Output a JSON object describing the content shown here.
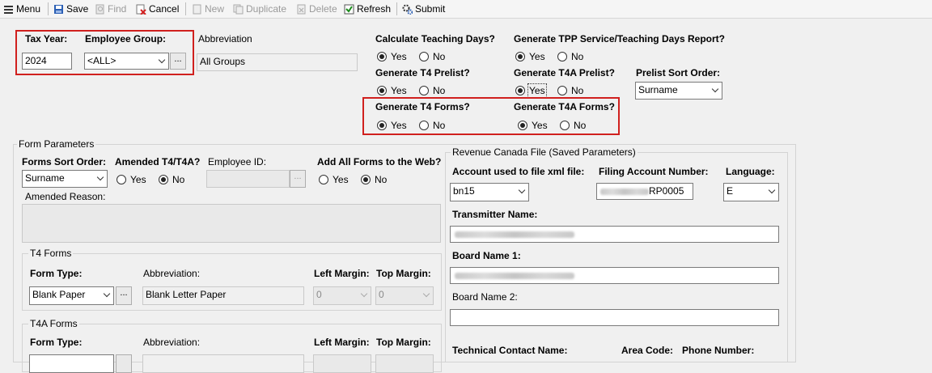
{
  "toolbar": {
    "menu": "Menu",
    "save": "Save",
    "find": "Find",
    "cancel": "Cancel",
    "new": "New",
    "duplicate": "Duplicate",
    "delete": "Delete",
    "refresh": "Refresh",
    "submit": "Submit"
  },
  "header": {
    "tax_year_label": "Tax Year:",
    "tax_year_value": "2024",
    "employee_group_label": "Employee Group:",
    "employee_group_value": "<ALL>",
    "abbreviation_label": "Abbreviation",
    "abbreviation_value": "All Groups"
  },
  "options": {
    "calc_teaching_days": "Calculate Teaching Days?",
    "gen_tpp_report": "Generate TPP Service/Teaching Days Report?",
    "gen_t4_prelist": "Generate T4 Prelist?",
    "gen_t4a_prelist": "Generate T4A Prelist?",
    "prelist_sort_order": "Prelist Sort Order:",
    "prelist_sort_value": "Surname",
    "gen_t4_forms": "Generate T4 Forms?",
    "gen_t4a_forms": "Generate T4A Forms?",
    "yes": "Yes",
    "no": "No"
  },
  "form_params": {
    "title": "Form Parameters",
    "forms_sort_order": "Forms Sort Order:",
    "forms_sort_value": "Surname",
    "amended": "Amended T4/T4A?",
    "employee_id": "Employee ID:",
    "add_all_web": "Add All Forms to the Web?",
    "amended_reason": "Amended Reason:"
  },
  "t4_forms": {
    "title": "T4 Forms",
    "form_type": "Form Type:",
    "form_type_value": "Blank Paper",
    "abbreviation": "Abbreviation:",
    "abbreviation_value": "Blank Letter Paper",
    "left_margin": "Left Margin:",
    "left_margin_value": "0",
    "top_margin": "Top Margin:",
    "top_margin_value": "0"
  },
  "t4a_forms": {
    "title": "T4A Forms",
    "form_type": "Form Type:",
    "abbreviation": "Abbreviation:",
    "left_margin": "Left Margin:",
    "top_margin": "Top Margin:"
  },
  "revenue": {
    "title": "Revenue Canada File (Saved Parameters)",
    "account_label": "Account used to file xml file:",
    "account_value": "bn15",
    "filing_label": "Filing Account Number:",
    "filing_value": "RP0005",
    "language_label": "Language:",
    "language_value": "E",
    "transmitter_label": "Transmitter Name:",
    "board1_label": "Board Name 1:",
    "board2_label": "Board Name 2:",
    "tech_contact_label": "Technical Contact Name:",
    "area_code_label": "Area Code:",
    "phone_label": "Phone Number:"
  },
  "colors": {
    "highlight_box": "#d0201e"
  }
}
